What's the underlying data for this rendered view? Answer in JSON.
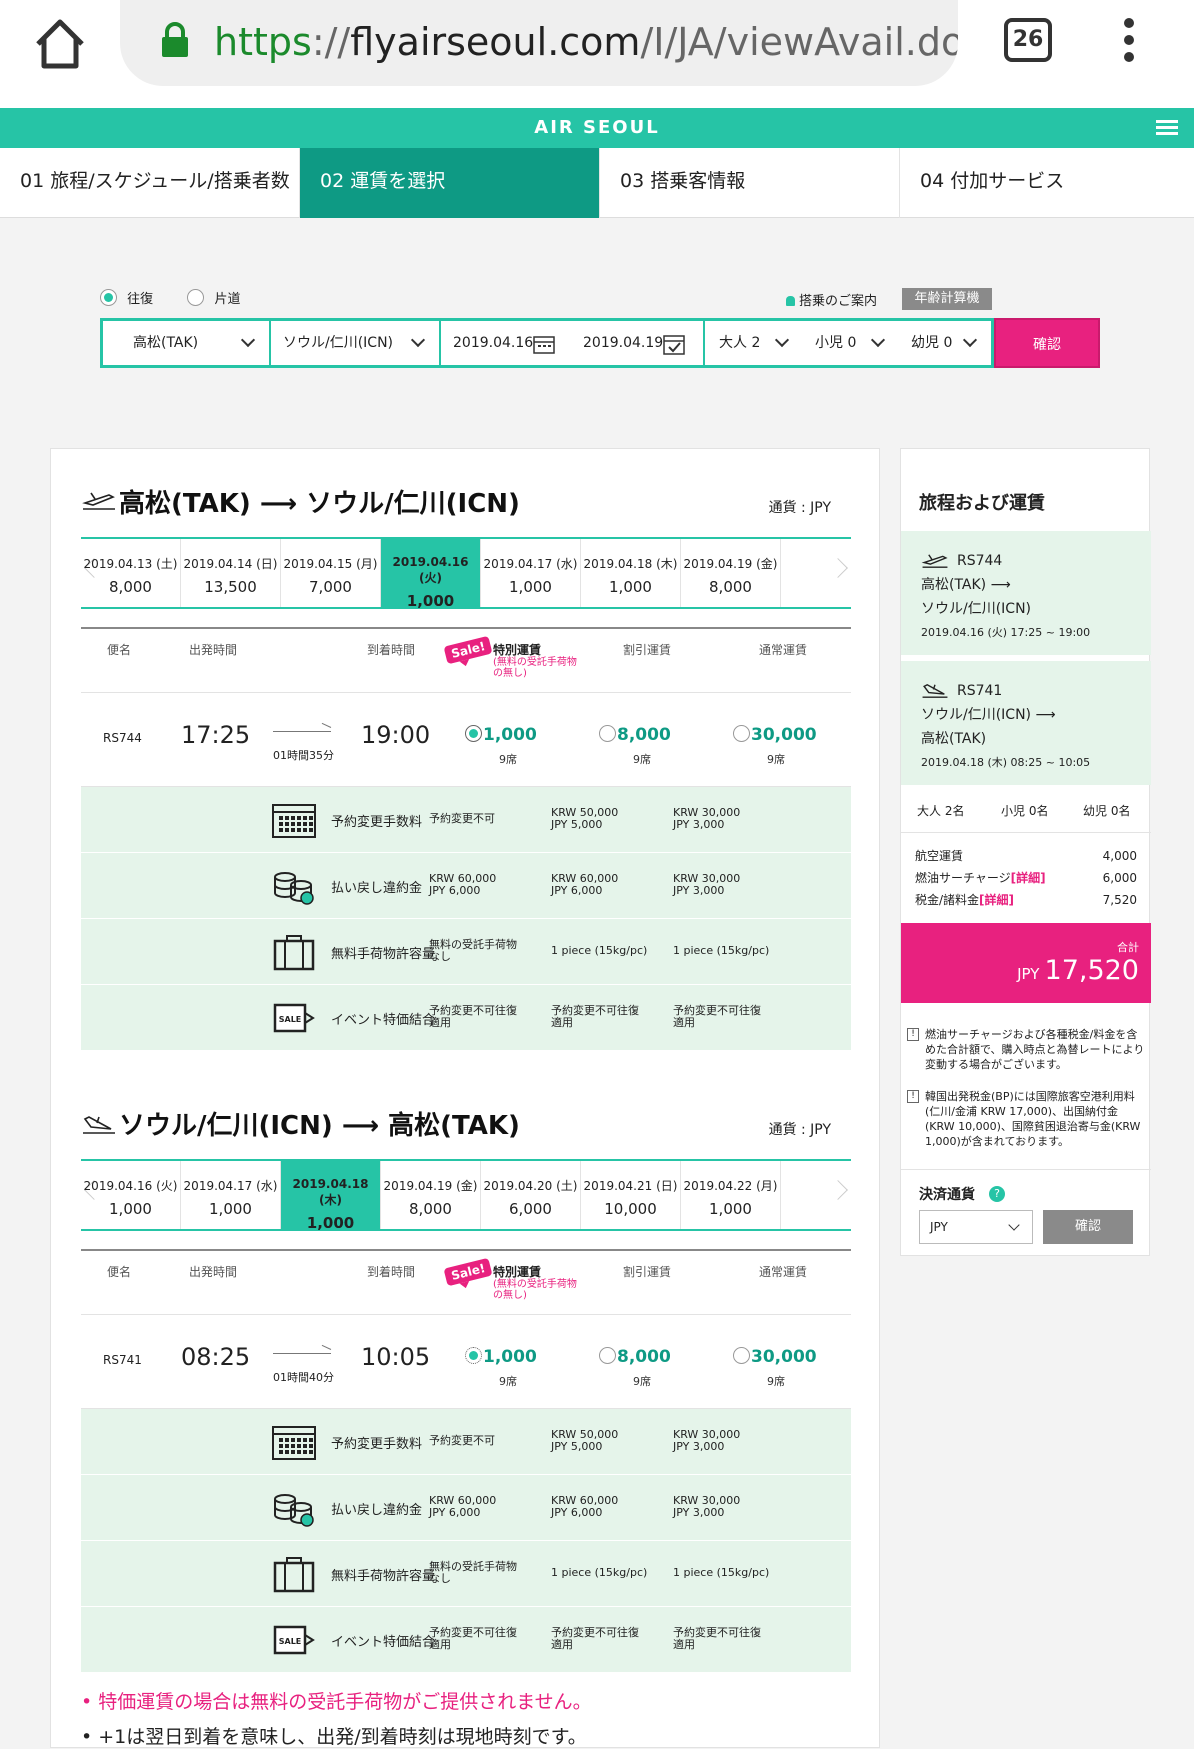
{
  "browser": {
    "url_scheme": "https",
    "url_sep": "://",
    "url_host": "flyairseoul.com",
    "url_path": "/I/JA/viewAvail.do",
    "tab_count": "26"
  },
  "brand": {
    "logo": "AIR SEOUL"
  },
  "steps": [
    "01 旅程/スケジュール/搭乗者数",
    "02 運賃を選択",
    "03 搭乗客情報",
    "04 付加サービス"
  ],
  "search": {
    "round_trip": "往復",
    "one_way": "片道",
    "guide": "搭乗のご案内",
    "age_calc": "年齢計算機",
    "origin": "高松(TAK)",
    "destination": "ソウル/仁川(ICN)",
    "depart": "2019.04.16",
    "return": "2019.04.19",
    "adult": "大人 2",
    "child": "小児 0",
    "infant": "幼児 0",
    "confirm": "確認"
  },
  "common": {
    "currency": "通貨 : JPY",
    "col_flight": "便名",
    "col_dep": "出発時間",
    "col_arr": "到着時間",
    "col_special": "特別運賃",
    "col_special_note": "(無料の受託手荷物の無し)",
    "col_discount": "割引運賃",
    "col_normal": "通常運賃",
    "sale": "Sale!",
    "det_labels": [
      "予約変更手数料",
      "払い戻し違約金",
      "無料手荷物許容量",
      "イベント特価結合"
    ],
    "det_cells": [
      [
        "予約変更不可",
        "KRW 50,000\nJPY 5,000",
        "KRW 30,000\nJPY 3,000"
      ],
      [
        "KRW 60,000\nJPY 6,000",
        "KRW 60,000\nJPY 6,000",
        "KRW 30,000\nJPY 3,000"
      ],
      [
        "無料の受託手荷物\nなし",
        "1 piece (15kg/pc)",
        "1 piece (15kg/pc)"
      ],
      [
        "予約変更不可往復\n適用",
        "予約変更不可往復\n適用",
        "予約変更不可往復\n適用"
      ]
    ],
    "fare_special": "1,000",
    "fare_discount": "8,000",
    "fare_normal": "30,000",
    "seats": "9席"
  },
  "outbound": {
    "from": "高松(TAK)",
    "to": "ソウル/仁川(ICN)",
    "dates": [
      {
        "d": "2019.04.13 (土)",
        "p": "8,000"
      },
      {
        "d": "2019.04.14 (日)",
        "p": "13,500"
      },
      {
        "d": "2019.04.15 (月)",
        "p": "7,000"
      },
      {
        "d": "2019.04.16 (火)",
        "p": "1,000"
      },
      {
        "d": "2019.04.17 (水)",
        "p": "1,000"
      },
      {
        "d": "2019.04.18 (木)",
        "p": "1,000"
      },
      {
        "d": "2019.04.19 (金)",
        "p": "8,000"
      }
    ],
    "selected_index": 3,
    "flight": {
      "no": "RS744",
      "dep": "17:25",
      "arr": "19:00",
      "dur": "01時間35分"
    }
  },
  "inbound": {
    "from": "ソウル/仁川(ICN)",
    "to": "高松(TAK)",
    "dates": [
      {
        "d": "2019.04.16 (火)",
        "p": "1,000"
      },
      {
        "d": "2019.04.17 (水)",
        "p": "1,000"
      },
      {
        "d": "2019.04.18 (木)",
        "p": "1,000"
      },
      {
        "d": "2019.04.19 (金)",
        "p": "8,000"
      },
      {
        "d": "2019.04.20 (土)",
        "p": "6,000"
      },
      {
        "d": "2019.04.21 (日)",
        "p": "10,000"
      },
      {
        "d": "2019.04.22 (月)",
        "p": "1,000"
      }
    ],
    "selected_index": 2,
    "flight": {
      "no": "RS741",
      "dep": "08:25",
      "arr": "10:05",
      "dur": "01時間40分"
    }
  },
  "notes": [
    "特価運賃の場合は無料の受託手荷物がご提供されません。",
    "+1は翌日到着を意味し、出発/到着時刻は現地時刻です。"
  ],
  "summary": {
    "title": "旅程および運賃",
    "seg1": {
      "flight": "RS744",
      "route1": "高松(TAK) ⟶",
      "route2": "ソウル/仁川(ICN)",
      "time": "2019.04.16 (火) 17:25 ~ 19:00"
    },
    "seg2": {
      "flight": "RS741",
      "route1": "ソウル/仁川(ICN) ⟶",
      "route2": "高松(TAK)",
      "time": "2019.04.18 (木) 08:25 ~ 10:05"
    },
    "pax": [
      "大人 2名",
      "小児 0名",
      "幼児 0名"
    ],
    "fees": [
      {
        "label": "航空運賃",
        "detail": "",
        "amount": "4,000"
      },
      {
        "label": "燃油サーチャージ",
        "detail": "[詳細]",
        "amount": "6,000"
      },
      {
        "label": "税金/諸料金",
        "detail": "[詳細]",
        "amount": "7,520"
      }
    ],
    "total_label": "合計",
    "total_currency": "JPY",
    "total": "17,520",
    "note1": "燃油サーチャージおよび各種税金/料金を含めた合計額で、購入時点と為替レートにより変動する場合がございます。",
    "note2": "韓国出発税金(BP)には国際旅客空港利用料(仁川/金浦 KRW 17,000)、出国納付金(KRW 10,000)、国際貧困退治寄与金(KRW 1,000)が含まれております。",
    "pay_title": "決済通貨",
    "pay_value": "JPY",
    "pay_confirm": "確認"
  }
}
